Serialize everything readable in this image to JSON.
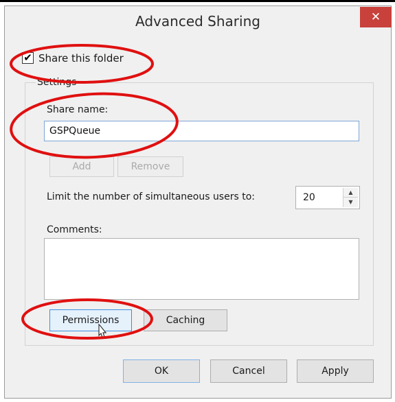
{
  "window": {
    "title": "Advanced Sharing",
    "close_glyph": "✕"
  },
  "share_checkbox": {
    "label": "Share this folder",
    "checked": true,
    "glyph": "✔"
  },
  "settings": {
    "legend": "Settings",
    "share_name_label": "Share name:",
    "share_name_value": "GSPQueue",
    "add_label": "Add",
    "remove_label": "Remove",
    "limit_label": "Limit the number of simultaneous users to:",
    "limit_value": "20",
    "comments_label": "Comments:",
    "comments_value": "",
    "permissions_label": "Permissions",
    "caching_label": "Caching"
  },
  "footer": {
    "ok_label": "OK",
    "cancel_label": "Cancel",
    "apply_label": "Apply"
  },
  "colors": {
    "close_button": "#c8413b",
    "annotation": "#e01010",
    "focus_border": "#3d8ee0"
  }
}
